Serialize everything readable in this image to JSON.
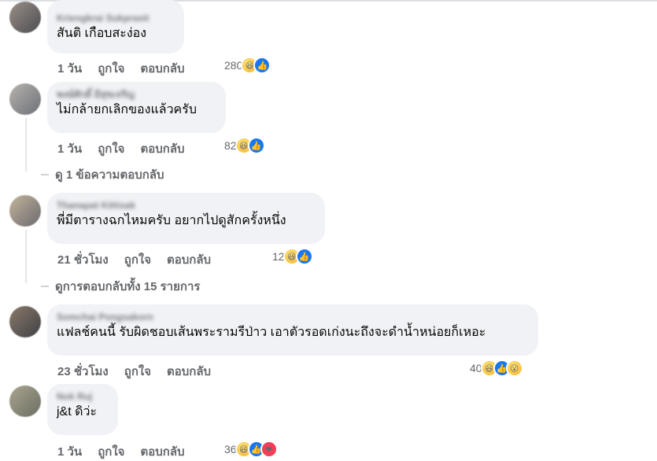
{
  "comments": [
    {
      "author": "Kriengkrai Sukprasit",
      "text": "สันติ เกือบสะง่อง",
      "time": "1 วัน",
      "like": "ถูกใจ",
      "reply": "ตอบกลับ",
      "count": "280",
      "reactions": [
        "haha",
        "like"
      ]
    },
    {
      "author": "พงษ์ศักดิ์ มีสุขเจริญ",
      "text": "ไม่กล้ายกเลิกของแล้วครับ",
      "time": "1 วัน",
      "like": "ถูกใจ",
      "reply": "ตอบกลับ",
      "count": "82",
      "reactions": [
        "haha",
        "like"
      ],
      "view_replies": "ดู 1 ข้อความตอบกลับ"
    },
    {
      "author": "Thanapat Kittisak",
      "text": "พี่มีตารางฉกไหมครับ อยากไปดูสักครั้งหนึ่ง",
      "time": "21 ชั่วโมง",
      "like": "ถูกใจ",
      "reply": "ตอบกลับ",
      "count": "12",
      "reactions": [
        "haha",
        "like"
      ],
      "view_replies": "ดูการตอบกลับทั้ง 15 รายการ"
    },
    {
      "author": "Somchai Pongsakorn",
      "text": "แฟลช์คนนี้ รับผิดชอบเส้นพระรามรีป่าว เอาตัวรอดเก่งนะถึงจะดำน้ำหน่อยก็เหอะ",
      "time": "23 ชั่วโมง",
      "like": "ถูกใจ",
      "reply": "ตอบกลับ",
      "count": "40",
      "reactions": [
        "haha",
        "like",
        "wow"
      ]
    },
    {
      "author": "Nok Ruj",
      "text": "j&t ดิว่ะ",
      "time": "1 วัน",
      "like": "ถูกใจ",
      "reply": "ตอบกลับ",
      "count": "36",
      "reactions": [
        "haha",
        "like",
        "love"
      ]
    }
  ],
  "colors": {
    "bubble": "#f0f2f5",
    "secondary_text": "#65676b",
    "like_blue": "#1877f2",
    "love_red": "#f33e58",
    "haha_yellow": "#f7b125"
  }
}
